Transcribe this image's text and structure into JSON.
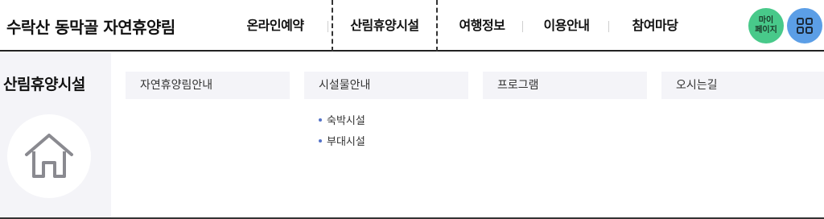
{
  "header": {
    "site_title": "수락산 동막골 자연휴양림",
    "nav": [
      {
        "label": "온라인예약"
      },
      {
        "label": "산림휴양시설"
      },
      {
        "label": "여행정보"
      },
      {
        "label": "이용안내"
      },
      {
        "label": "참여마당"
      }
    ],
    "mypage_label_line1": "마이",
    "mypage_label_line2": "페이지",
    "menu_icon": "grid-menu-icon"
  },
  "sidebar": {
    "title": "산림휴양시설",
    "icon": "home-icon"
  },
  "submenu": {
    "categories": [
      {
        "label": "자연휴양림안내"
      },
      {
        "label": "시설물안내",
        "items": [
          "숙박시설",
          "부대시설"
        ]
      },
      {
        "label": "프로그램"
      },
      {
        "label": "오시는길"
      }
    ]
  },
  "colors": {
    "mypage": "#48c98a",
    "menu": "#5b9ee6",
    "bullet": "#5573c8",
    "panel": "#f4f4f8"
  }
}
